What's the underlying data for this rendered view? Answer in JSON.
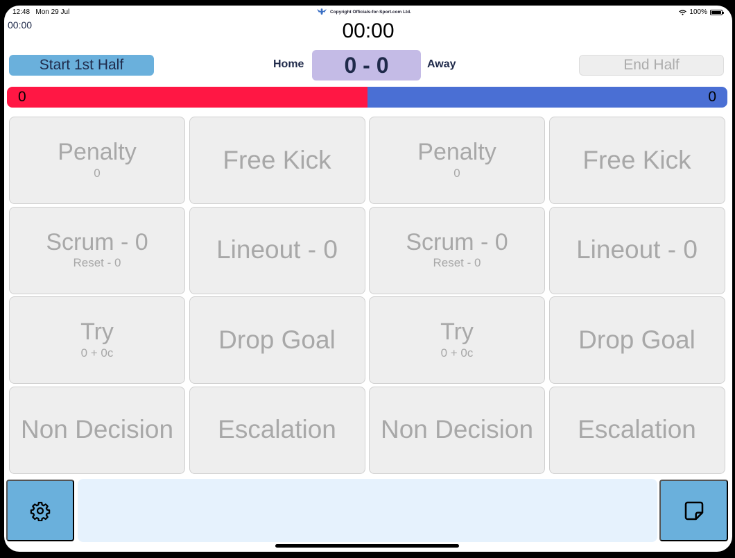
{
  "status_bar": {
    "time": "12:48",
    "date": "Mon 29 Jul",
    "battery": "100%",
    "wifi_icon": "wifi-icon",
    "battery_icon": "battery-icon"
  },
  "header": {
    "copyright": "Copyright Officials-for-Sport.com Ltd.",
    "logo_icon": "officials-logo-icon",
    "small_clock": "00:00",
    "main_clock": "00:00"
  },
  "controls": {
    "start_label": "Start 1st Half",
    "end_label": "End Half",
    "home_label": "Home",
    "away_label": "Away",
    "score": "0 - 0"
  },
  "possession": {
    "home_value": "0",
    "away_value": "0",
    "home_color": "#ff1744",
    "away_color": "#4a6fd4",
    "home_fraction": 0.5
  },
  "tiles": [
    {
      "main": "Penalty",
      "sub": "0"
    },
    {
      "main": "Free Kick",
      "sub": ""
    },
    {
      "main": "Penalty",
      "sub": "0"
    },
    {
      "main": "Free Kick",
      "sub": ""
    },
    {
      "main": "Scrum - 0",
      "sub": "Reset - 0"
    },
    {
      "main": "Lineout - 0",
      "sub": ""
    },
    {
      "main": "Scrum - 0",
      "sub": "Reset - 0"
    },
    {
      "main": "Lineout - 0",
      "sub": ""
    },
    {
      "main": "Try",
      "sub": "0 + 0c"
    },
    {
      "main": "Drop Goal",
      "sub": ""
    },
    {
      "main": "Try",
      "sub": "0 + 0c"
    },
    {
      "main": "Drop Goal",
      "sub": ""
    },
    {
      "main": "Non Decision",
      "sub": ""
    },
    {
      "main": "Escalation",
      "sub": ""
    },
    {
      "main": "Non Decision",
      "sub": ""
    },
    {
      "main": "Escalation",
      "sub": ""
    }
  ],
  "bottom": {
    "settings_icon": "gear-icon",
    "notes_icon": "sticky-note-icon",
    "notes_field": ""
  },
  "colors": {
    "accent_blue": "#6ab0dc",
    "score_bg": "#c4bbe6",
    "text_dark": "#1f2a4a"
  }
}
